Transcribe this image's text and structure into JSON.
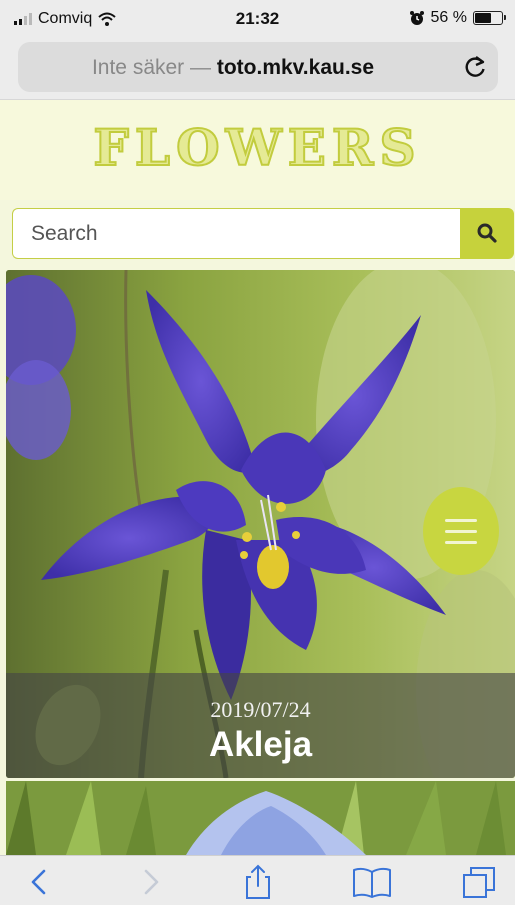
{
  "status_bar": {
    "carrier": "Comviq",
    "time": "21:32",
    "battery_percent": "56 %",
    "battery_level": 0.56,
    "icons": [
      "signal-icon",
      "wifi-icon",
      "alarm-icon",
      "battery-icon"
    ]
  },
  "browser": {
    "security_label": "Inte säker —",
    "host": "toto.mkv.kau.se",
    "reload_icon": "reload-icon"
  },
  "site": {
    "logo_text": "FLOWERS",
    "search": {
      "placeholder": "Search",
      "value": "",
      "button_icon": "search-icon"
    },
    "accent_color": "#c6d23c"
  },
  "featured_post": {
    "date": "2019/07/24",
    "title": "Akleja",
    "menu_icon": "hamburger-icon"
  },
  "toolbar": {
    "items": [
      "back-icon",
      "forward-icon",
      "share-icon",
      "bookmarks-icon",
      "tabs-icon"
    ]
  }
}
